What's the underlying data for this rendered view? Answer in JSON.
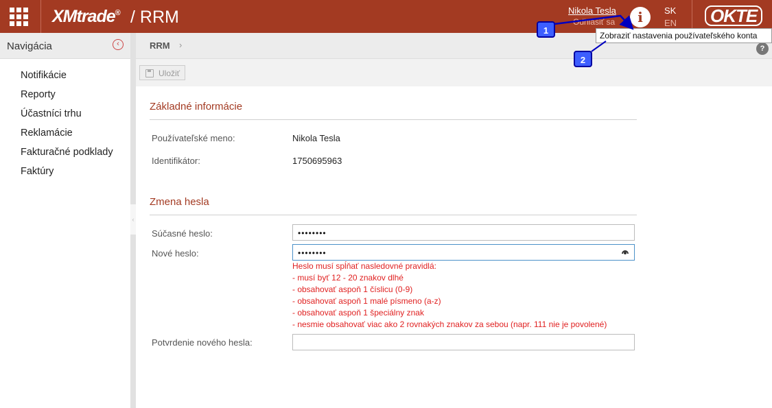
{
  "header": {
    "logo": "XMtrade",
    "logo_mark": "®",
    "separator": "/",
    "app_name": "RRM",
    "user_name": "Nikola Tesla",
    "logout": "Odhlásiť sa",
    "info_glyph": "i",
    "lang_sk": "SK",
    "lang_en": "EN",
    "brand": "OKTE"
  },
  "sidebar": {
    "title": "Navigácia",
    "items": [
      {
        "label": "Notifikácie"
      },
      {
        "label": "Reporty"
      },
      {
        "label": "Účastníci trhu"
      },
      {
        "label": "Reklamácie"
      },
      {
        "label": "Fakturačné podklady"
      },
      {
        "label": "Faktúry"
      }
    ]
  },
  "breadcrumb": {
    "item": "RRM",
    "sep": "›"
  },
  "toolbar": {
    "save_label": "Uložiť"
  },
  "basic_info": {
    "title": "Základné informácie",
    "username_label": "Používateľské meno:",
    "username_value": "Nikola Tesla",
    "id_label": "Identifikátor:",
    "id_value": "1750695963"
  },
  "password": {
    "title": "Zmena hesla",
    "current_label": "Súčasné heslo:",
    "current_value": "••••••••",
    "new_label": "Nové heslo:",
    "new_value": "••••••••",
    "rules": [
      "Heslo musí spĺňať nasledovné pravidlá:",
      "- musí byť 12 - 20 znakov dlhé",
      "- obsahovať aspoň 1 číslicu (0-9)",
      "- obsahovať aspoň 1 malé písmeno (a-z)",
      "- obsahovať aspoň 1 špeciálny znak",
      "- nesmie obsahovať viac ako 2 rovnakých znakov za sebou (napr. 111 nie je povolené)"
    ],
    "confirm_label": "Potvrdenie nového hesla:",
    "confirm_value": ""
  },
  "callouts": {
    "tooltip": "Zobraziť nastavenia používateľského konta",
    "badge1": "1",
    "badge2": "2"
  }
}
